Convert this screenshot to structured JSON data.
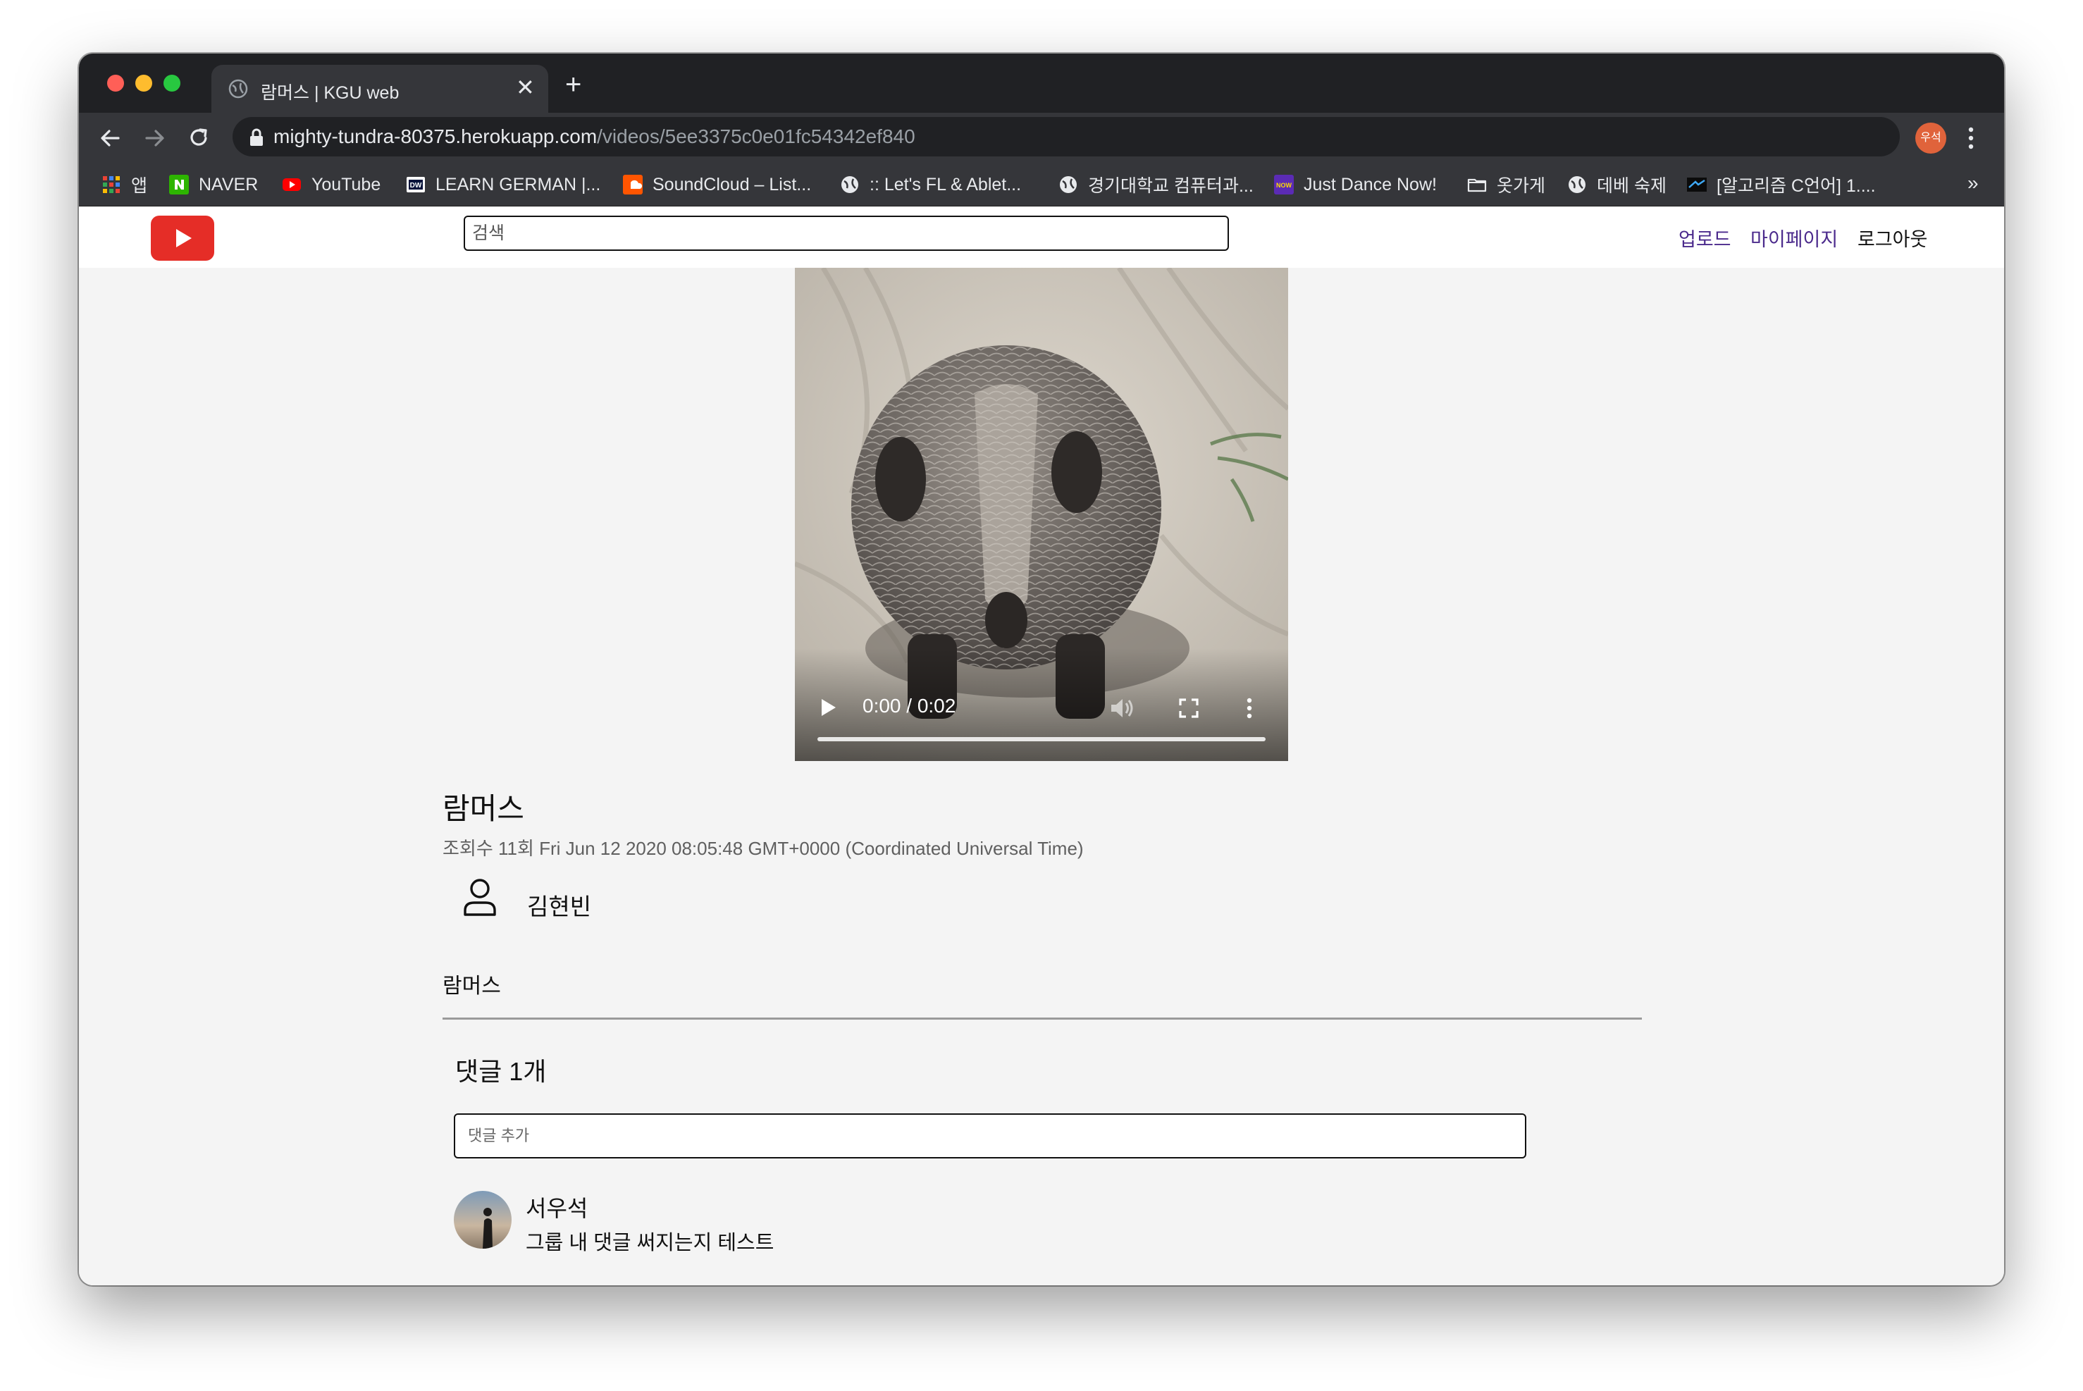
{
  "browser": {
    "tab_title": "람머스 | KGU web",
    "tab_close": "✕",
    "new_tab": "+",
    "url_host": "mighty-tundra-80375.herokuapp.com",
    "url_path": "/videos/5ee3375c0e01fc54342ef840",
    "profile_initials": "우석",
    "bookmarks_more": "»",
    "bookmarks": [
      {
        "label": "앱",
        "icon": "apps-grid-icon"
      },
      {
        "label": "NAVER",
        "icon": "naver-icon"
      },
      {
        "label": "YouTube",
        "icon": "youtube-icon"
      },
      {
        "label": "LEARN GERMAN |...",
        "icon": "dw-icon"
      },
      {
        "label": "SoundCloud – List...",
        "icon": "soundcloud-icon"
      },
      {
        "label": ":: Let's FL & Ablet...",
        "icon": "globe-icon"
      },
      {
        "label": "경기대학교 컴퓨터과...",
        "icon": "globe-icon"
      },
      {
        "label": "Just Dance Now!",
        "icon": "just-dance-icon"
      },
      {
        "label": "옷가게",
        "icon": "folder-icon"
      },
      {
        "label": "데베 숙제",
        "icon": "globe-icon"
      },
      {
        "label": "[알고리즘 C언어] 1....",
        "icon": "site-icon"
      }
    ]
  },
  "header": {
    "search_placeholder": "검색",
    "links": {
      "upload": "업로드",
      "mypage": "마이페이지",
      "logout": "로그아웃"
    },
    "brand_color": "#e52d27"
  },
  "video": {
    "time": "0:00 / 0:02",
    "progress_fraction": 0
  },
  "main": {
    "title": "람머스",
    "meta": "조회수 11회 Fri Jun 12 2020 08:05:48 GMT+0000 (Coordinated Universal Time)",
    "author": "김현빈",
    "description": "람머스"
  },
  "comments": {
    "count_label": "댓글 1개",
    "input_placeholder": "댓글 추가",
    "items": [
      {
        "author": "서우석",
        "text": "그룹 내 댓글 써지는지 테스트"
      }
    ]
  }
}
